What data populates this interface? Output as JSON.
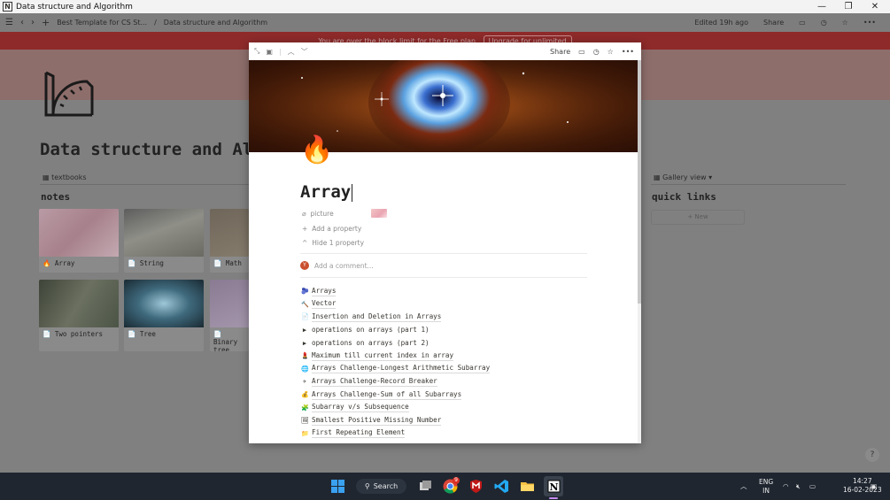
{
  "window": {
    "title": "Data structure and Algorithm",
    "controls": [
      "—",
      "❐",
      "✕"
    ]
  },
  "topbar": {
    "breadcrumbs": [
      "Best Template for CS St...",
      "Data structure and Algorithm"
    ],
    "edited": "Edited 19h ago",
    "share": "Share"
  },
  "banner": {
    "text": "You are over the block limit for the Free plan.",
    "button": "Upgrade for unlimited"
  },
  "page": {
    "title": "Data structure and Algorithm",
    "db_tab": "textbooks",
    "notes_heading": "notes",
    "cards": [
      {
        "label": "Array",
        "icon": "🔥"
      },
      {
        "label": "String",
        "icon": "📄"
      },
      {
        "label": "Math",
        "icon": "📄"
      },
      {
        "label": "Two pointers",
        "icon": "📄"
      },
      {
        "label": "Tree",
        "icon": "📄"
      },
      {
        "label": "Binary tree",
        "icon": "📄"
      }
    ],
    "gallery_view": "Gallery view",
    "quick_links": "quick links",
    "new_label": "+ New",
    "help": "?"
  },
  "modal": {
    "share": "Share",
    "emoji": "🔥",
    "title": "Array",
    "property_name": "picture",
    "add_property": "Add a property",
    "hide_property": "Hide 1 property",
    "comment_placeholder": "Add a comment...",
    "avatar_letter": "Y",
    "items": [
      {
        "icon": "🫐",
        "text": "Arrays",
        "toggle": false
      },
      {
        "icon": "🔨",
        "text": "Vector",
        "toggle": false
      },
      {
        "icon": "📄",
        "text": "Insertion and Deletion in Arrays",
        "toggle": false
      },
      {
        "icon": "▶",
        "text": "operations on arrays (part 1)",
        "toggle": true
      },
      {
        "icon": "▶",
        "text": "operations on arrays (part 2)",
        "toggle": true
      },
      {
        "icon": "💄",
        "text": "Maximum till current index in array",
        "toggle": false
      },
      {
        "icon": "🌐",
        "text": "Arrays Challenge-Longest Arithmetic Subarray",
        "toggle": false
      },
      {
        "icon": "✈",
        "text": "Arrays Challenge-Record Breaker",
        "toggle": false
      },
      {
        "icon": "💰",
        "text": "Arrays Challenge-Sum of all Subarrays",
        "toggle": false
      },
      {
        "icon": "🧩",
        "text": "Subarray v/s Subsequence",
        "toggle": false
      },
      {
        "icon": "🖼",
        "text": "Smallest Positive Missing Number",
        "toggle": false
      },
      {
        "icon": "📁",
        "text": "First Repeating Element",
        "toggle": false
      }
    ]
  },
  "taskbar": {
    "search": "Search",
    "lang": "ENG",
    "region": "IN",
    "time": "14:27",
    "date": "16-02-2023",
    "chrome_badge": "9"
  },
  "colors": {
    "banner": "#8e2a2a",
    "taskbar": "#1f2630",
    "overlay": "#7f7f7f"
  }
}
